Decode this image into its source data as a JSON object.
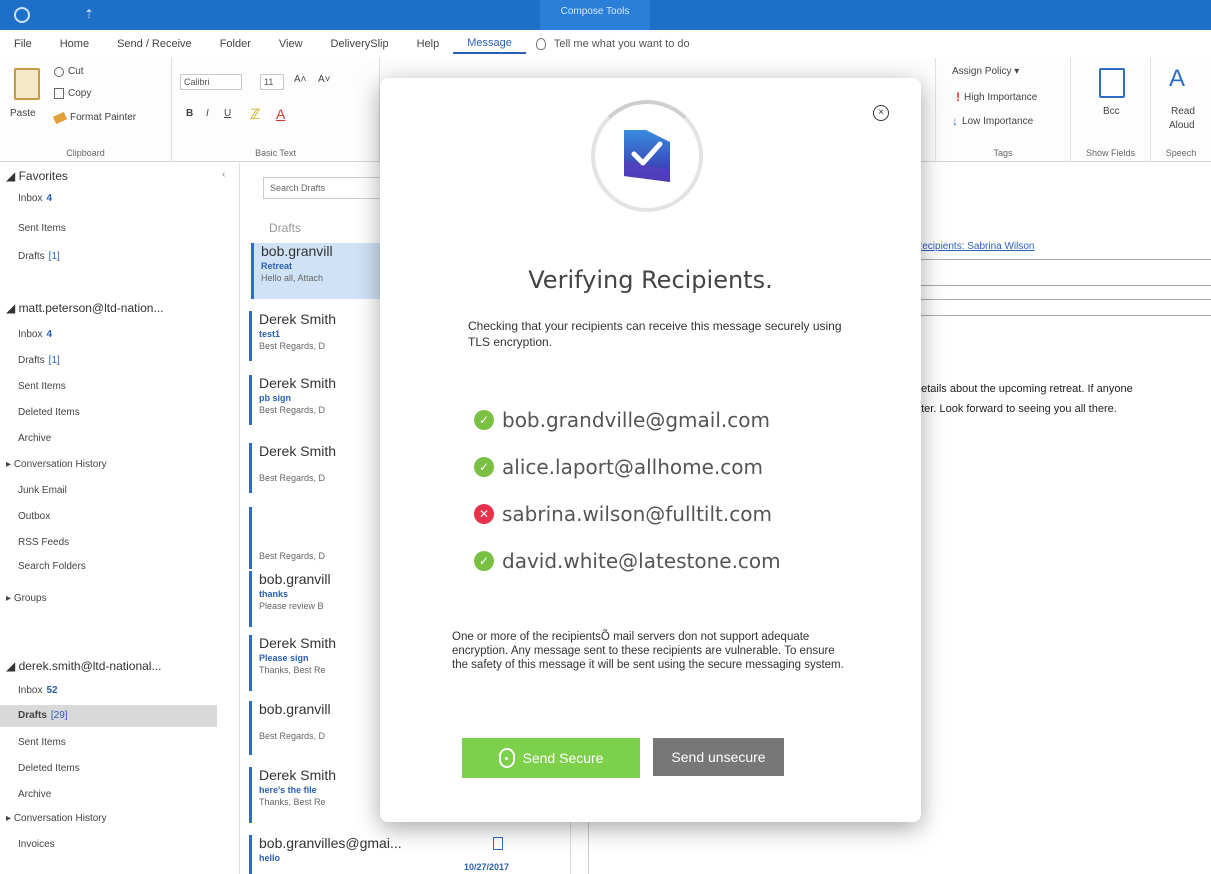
{
  "titlebar": {
    "context_tab": "Compose Tools",
    "qa": "⇡"
  },
  "tabs": [
    "File",
    "Home",
    "Send / Receive",
    "Folder",
    "View",
    "DeliverySlip",
    "Help",
    "Message"
  ],
  "active_tab": "Message",
  "tellme": "Tell me what you want to do",
  "ribbon": {
    "clipboard": {
      "paste": "Paste",
      "cut": "Cut",
      "copy": "Copy",
      "format_painter": "Format Painter",
      "label": "Clipboard"
    },
    "basic_text": {
      "font": "Calibri",
      "size": "11",
      "label": "Basic Text",
      "bold": "B",
      "italic": "I",
      "underline": "U",
      "grow": "A˄",
      "shrink": "A˅",
      "highlight": "ℤ",
      "font_color": "A"
    },
    "tags": {
      "assign_policy": "Assign Policy ▾",
      "high": "High Importance",
      "low": "Low Importance",
      "label": "Tags"
    },
    "show_fields": {
      "bcc": "Bcc",
      "label": "Show Fields"
    },
    "speech": {
      "read_line1": "Read",
      "read_line2": "Aloud",
      "label": "Speech"
    }
  },
  "folders": {
    "favorites": "Favorites",
    "fav_items": [
      {
        "name": "Inbox",
        "count": "4"
      },
      {
        "name": "Sent Items",
        "count": ""
      },
      {
        "name": "Drafts",
        "count": "[1]"
      }
    ],
    "account1": "matt.peterson@ltd-nation...",
    "acc1_items": [
      {
        "name": "Inbox",
        "count": "4"
      },
      {
        "name": "Drafts",
        "count": "[1]"
      },
      {
        "name": "Sent Items",
        "count": ""
      },
      {
        "name": "Deleted Items",
        "count": ""
      },
      {
        "name": "Archive",
        "count": ""
      },
      {
        "name": "Conversation History",
        "count": ""
      },
      {
        "name": "Junk Email",
        "count": ""
      },
      {
        "name": "Outbox",
        "count": ""
      },
      {
        "name": "RSS Feeds",
        "count": ""
      },
      {
        "name": "Search Folders",
        "count": ""
      }
    ],
    "groups": "Groups",
    "account2": "derek.smith@ltd-national...",
    "acc2_items": [
      {
        "name": "Inbox",
        "count": "52"
      },
      {
        "name": "Drafts",
        "count": "[29]"
      },
      {
        "name": "Sent Items",
        "count": ""
      },
      {
        "name": "Deleted Items",
        "count": ""
      },
      {
        "name": "Archive",
        "count": ""
      },
      {
        "name": "Conversation History",
        "count": ""
      },
      {
        "name": "Invoices",
        "count": ""
      }
    ]
  },
  "msglist": {
    "search_placeholder": "Search Drafts",
    "title": "Drafts",
    "messages": [
      {
        "from": "bob.granvill",
        "subject": "Retreat",
        "preview": "Hello all, Attach"
      },
      {
        "from": "Derek Smith",
        "subject": "test1",
        "preview": "Best Regards, D"
      },
      {
        "from": "Derek Smith",
        "subject": "pb sign",
        "preview": "Best Regards, D"
      },
      {
        "from": "Derek Smith",
        "subject": "",
        "preview": "Best Regards, D"
      },
      {
        "from": "",
        "subject": "",
        "preview": "Best Regards, D"
      },
      {
        "from": "bob.granvill",
        "subject": "thanks",
        "preview": "Please review B"
      },
      {
        "from": "Derek Smith",
        "subject": "Please sign",
        "preview": "Thanks, Best Re"
      },
      {
        "from": "bob.granvill",
        "subject": "",
        "preview": "Best Regards, D"
      },
      {
        "from": "Derek Smith",
        "subject": "here's the file",
        "preview": "Thanks, Best Re"
      },
      {
        "from": "bob.granvilles@gmai...",
        "subject": "hello",
        "preview": "",
        "date": "10/27/2017"
      }
    ]
  },
  "reading": {
    "to_label": "Recipients: Sabrina Wilson",
    "body_line1": "details about the upcoming retreat. If anyone",
    "body_line2": "ater. Look forward to seeing you all there."
  },
  "modal": {
    "close": "×",
    "title": "Verifying Recipients.",
    "subtitle": "Checking that your recipients can receive this message securely using TLS encryption.",
    "recipients": [
      {
        "email": "bob.grandville@gmail.com",
        "ok": true
      },
      {
        "email": "alice.laport@allhome.com",
        "ok": true
      },
      {
        "email": "sabrina.wilson@fulltilt.com",
        "ok": false
      },
      {
        "email": "david.white@latestone.com",
        "ok": true
      }
    ],
    "ok_glyph": "✓",
    "bad_glyph": "✕",
    "warning": "One or more of the recipientsÕ mail servers don not support adequate encryption. Any message sent to these recipients are vulnerable.  To ensure the safety of this message it will be sent using the secure messaging system.",
    "send_secure": "Send Secure",
    "send_unsecure": "Send unsecure",
    "colors": {
      "ok": "#7ac043",
      "bad": "#e8314b",
      "secure": "#7cd04a",
      "unsecure": "#777777",
      "logo_top": "#3a8be0",
      "logo_bottom": "#3b2da8"
    }
  }
}
